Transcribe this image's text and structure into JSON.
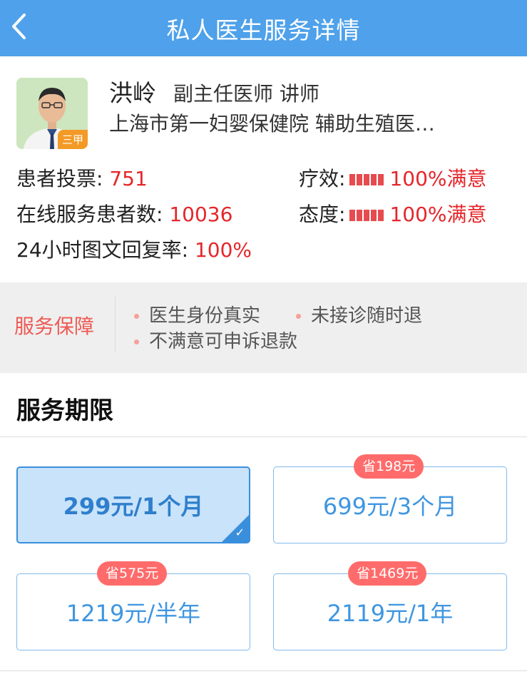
{
  "header": {
    "title": "私人医生服务详情"
  },
  "doctor": {
    "name": "洪岭",
    "title": "副主任医师 讲师",
    "hospital": "上海市第一妇婴保健院 辅助生殖医…",
    "badge": "三甲"
  },
  "stats": {
    "votes_label": "患者投票:",
    "votes_value": "751",
    "patients_label": "在线服务患者数:",
    "patients_value": "10036",
    "reply_label": "24小时图文回复率:",
    "reply_value": "100%",
    "efficacy_label": "疗效:",
    "efficacy_value": "100%满意",
    "attitude_label": "态度:",
    "attitude_value": "100%满意"
  },
  "guarantee": {
    "label": "服务保障",
    "items": [
      "医生身份真实",
      "未接诊随时退",
      "不满意可申诉退款"
    ]
  },
  "period": {
    "title": "服务期限",
    "options": [
      {
        "label": "299元/1个月",
        "save": "",
        "selected": true
      },
      {
        "label": "699元/3个月",
        "save": "省198元",
        "selected": false
      },
      {
        "label": "1219元/半年",
        "save": "省575元",
        "selected": false
      },
      {
        "label": "2119元/1年",
        "save": "省1469元",
        "selected": false
      }
    ]
  },
  "colors": {
    "header_bg": "#4ea1ea",
    "accent_red": "#e5262a",
    "option_border": "#7fb9ea",
    "selected_bg": "#c9e3fb",
    "save_badge": "#ff6b6b"
  },
  "icons": {
    "back": "chevron-left-icon",
    "check": "check-icon"
  }
}
